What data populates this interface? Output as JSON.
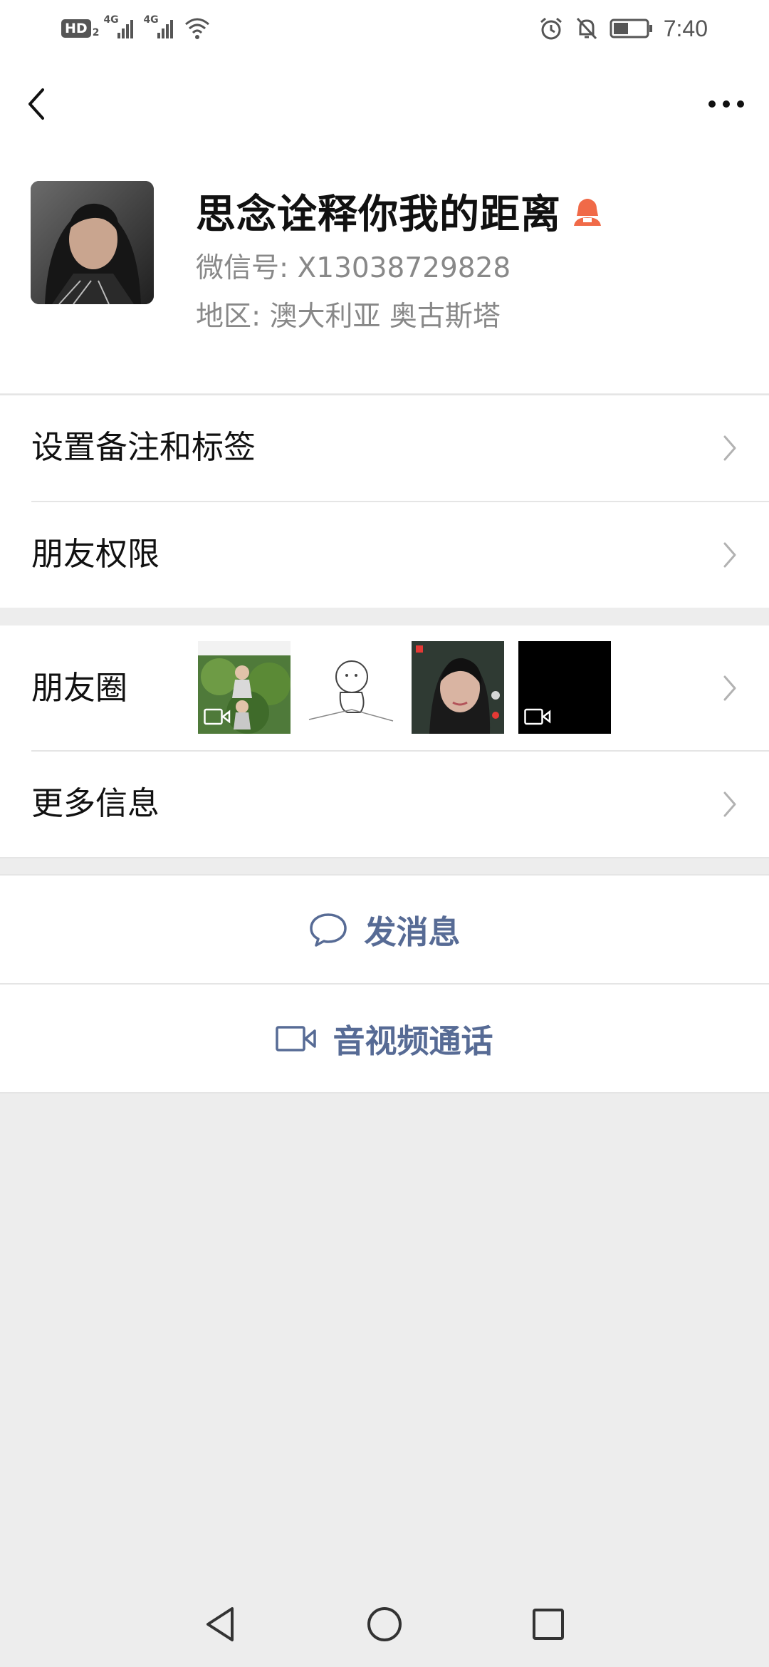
{
  "status_bar": {
    "hd": "HD",
    "hd_sub": "2",
    "net1": "4G",
    "net2": "4G",
    "time": "7:40"
  },
  "nav": {
    "back_icon": "chevron-left-icon",
    "more_icon": "more-horizontal-icon"
  },
  "profile": {
    "name": "思念诠释你我的距离",
    "gender_icon": "female-user-icon",
    "wechat_id": "微信号: X13038729828",
    "region": "地区: 澳大利亚  奥古斯塔"
  },
  "rows": {
    "remark_label": "设置备注和标签",
    "permission_label": "朋友权限",
    "moments_label": "朋友圈",
    "more_info_label": "更多信息"
  },
  "actions": {
    "message_label": "发消息",
    "call_label": "音视频通话",
    "accent": "#576b95"
  },
  "colors": {
    "gender": "#fa5151",
    "background": "#ededed"
  }
}
